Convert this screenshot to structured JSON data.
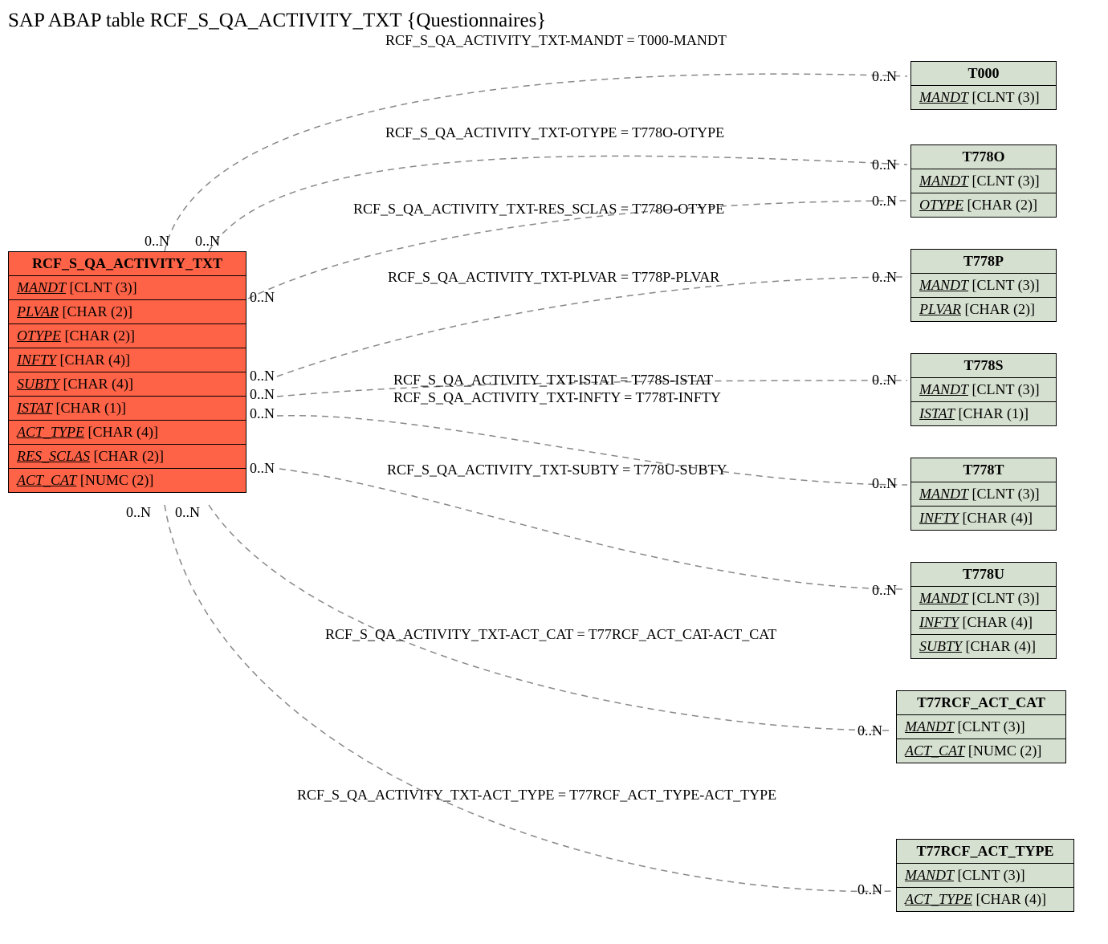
{
  "title": "SAP ABAP table RCF_S_QA_ACTIVITY_TXT {Questionnaires}",
  "source_entity": {
    "name": "RCF_S_QA_ACTIVITY_TXT",
    "fields": [
      {
        "name": "MANDT",
        "type": "[CLNT (3)]"
      },
      {
        "name": "PLVAR",
        "type": "[CHAR (2)]"
      },
      {
        "name": "OTYPE",
        "type": "[CHAR (2)]"
      },
      {
        "name": "INFTY",
        "type": "[CHAR (4)]"
      },
      {
        "name": "SUBTY",
        "type": "[CHAR (4)]"
      },
      {
        "name": "ISTAT",
        "type": "[CHAR (1)]"
      },
      {
        "name": "ACT_TYPE",
        "type": "[CHAR (4)]"
      },
      {
        "name": "RES_SCLAS",
        "type": "[CHAR (2)]"
      },
      {
        "name": "ACT_CAT",
        "type": "[NUMC (2)]"
      }
    ]
  },
  "target_entities": [
    {
      "name": "T000",
      "fields": [
        {
          "name": "MANDT",
          "type": "[CLNT (3)]"
        }
      ]
    },
    {
      "name": "T778O",
      "fields": [
        {
          "name": "MANDT",
          "type": "[CLNT (3)]"
        },
        {
          "name": "OTYPE",
          "type": "[CHAR (2)]"
        }
      ]
    },
    {
      "name": "T778P",
      "fields": [
        {
          "name": "MANDT",
          "type": "[CLNT (3)]"
        },
        {
          "name": "PLVAR",
          "type": "[CHAR (2)]"
        }
      ]
    },
    {
      "name": "T778S",
      "fields": [
        {
          "name": "MANDT",
          "type": "[CLNT (3)]"
        },
        {
          "name": "ISTAT",
          "type": "[CHAR (1)]"
        }
      ]
    },
    {
      "name": "T778T",
      "fields": [
        {
          "name": "MANDT",
          "type": "[CLNT (3)]"
        },
        {
          "name": "INFTY",
          "type": "[CHAR (4)]"
        }
      ]
    },
    {
      "name": "T778U",
      "fields": [
        {
          "name": "MANDT",
          "type": "[CLNT (3)]"
        },
        {
          "name": "INFTY",
          "type": "[CHAR (4)]"
        },
        {
          "name": "SUBTY",
          "type": "[CHAR (4)]"
        }
      ]
    },
    {
      "name": "T77RCF_ACT_CAT",
      "fields": [
        {
          "name": "MANDT",
          "type": "[CLNT (3)]"
        },
        {
          "name": "ACT_CAT",
          "type": "[NUMC (2)]"
        }
      ]
    },
    {
      "name": "T77RCF_ACT_TYPE",
      "fields": [
        {
          "name": "MANDT",
          "type": "[CLNT (3)]"
        },
        {
          "name": "ACT_TYPE",
          "type": "[CHAR (4)]"
        }
      ]
    }
  ],
  "relationships": [
    {
      "label": "RCF_S_QA_ACTIVITY_TXT-MANDT = T000-MANDT",
      "src_card": "0..N",
      "tgt_card": "0..N"
    },
    {
      "label": "RCF_S_QA_ACTIVITY_TXT-OTYPE = T778O-OTYPE",
      "src_card": "0..N",
      "tgt_card": "0..N"
    },
    {
      "label": "RCF_S_QA_ACTIVITY_TXT-RES_SCLAS = T778O-OTYPE",
      "src_card": "0..N",
      "tgt_card": "0..N"
    },
    {
      "label": "RCF_S_QA_ACTIVITY_TXT-PLVAR = T778P-PLVAR",
      "src_card": "0..N",
      "tgt_card": "0..N"
    },
    {
      "label": "RCF_S_QA_ACTIVITY_TXT-ISTAT = T778S-ISTAT",
      "src_card": "0..N",
      "tgt_card": "0..N"
    },
    {
      "label": "RCF_S_QA_ACTIVITY_TXT-INFTY = T778T-INFTY",
      "src_card": "0..N",
      "tgt_card": "0..N"
    },
    {
      "label": "RCF_S_QA_ACTIVITY_TXT-SUBTY = T778U-SUBTY",
      "src_card": "0..N",
      "tgt_card": "0..N"
    },
    {
      "label": "RCF_S_QA_ACTIVITY_TXT-ACT_CAT = T77RCF_ACT_CAT-ACT_CAT",
      "src_card": "0..N",
      "tgt_card": "0..N"
    },
    {
      "label": "RCF_S_QA_ACTIVITY_TXT-ACT_TYPE = T77RCF_ACT_TYPE-ACT_TYPE",
      "src_card": "0..N",
      "tgt_card": "0..N"
    }
  ],
  "src_cards": {
    "top_left": "0..N",
    "top_right": "0..N",
    "r1": "0..N",
    "r2": "0..N",
    "r3": "0..N",
    "r4": "0..N",
    "r5": "0..N",
    "bot_left": "0..N",
    "bot_right": "0..N"
  }
}
